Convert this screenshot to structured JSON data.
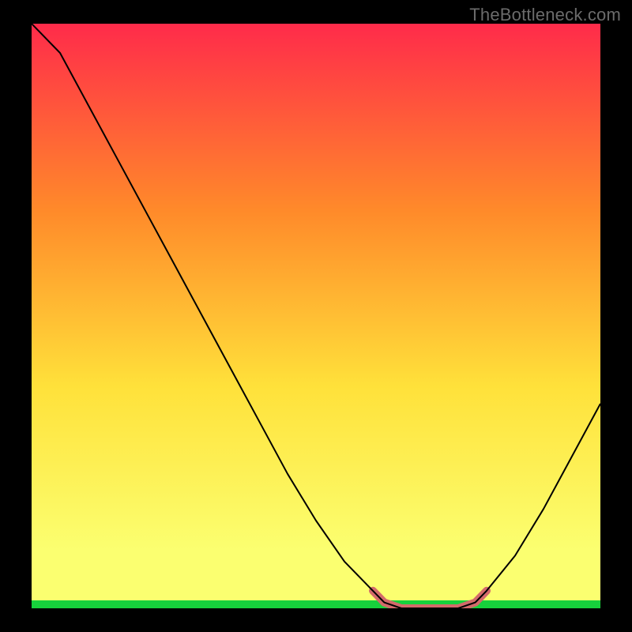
{
  "watermark": "TheBottleneck.com",
  "chart_data": {
    "type": "line",
    "title": "",
    "xlabel": "",
    "ylabel": "",
    "xlim": [
      0,
      100
    ],
    "ylim": [
      0,
      100
    ],
    "grid": false,
    "legend": false,
    "gradient_colors": {
      "top": "#ff2b4a",
      "mid1": "#ff8a2a",
      "mid2": "#ffe13a",
      "low": "#fbff70",
      "bottom": "#17d13c"
    },
    "series": [
      {
        "name": "bottleneck-curve",
        "color": "#000000",
        "x": [
          0,
          5,
          10,
          15,
          20,
          25,
          30,
          35,
          40,
          45,
          50,
          55,
          60,
          62,
          65,
          70,
          75,
          78,
          80,
          85,
          90,
          95,
          100
        ],
        "y": [
          100,
          95,
          86,
          77,
          68,
          59,
          50,
          41,
          32,
          23,
          15,
          8,
          3,
          1,
          0,
          0,
          0,
          1,
          3,
          9,
          17,
          26,
          35
        ]
      },
      {
        "name": "optimal-range-highlight",
        "color": "#d36a6a",
        "x": [
          60,
          62,
          65,
          70,
          75,
          78,
          80
        ],
        "y": [
          3,
          1,
          0,
          0,
          0,
          1,
          3
        ]
      }
    ]
  }
}
